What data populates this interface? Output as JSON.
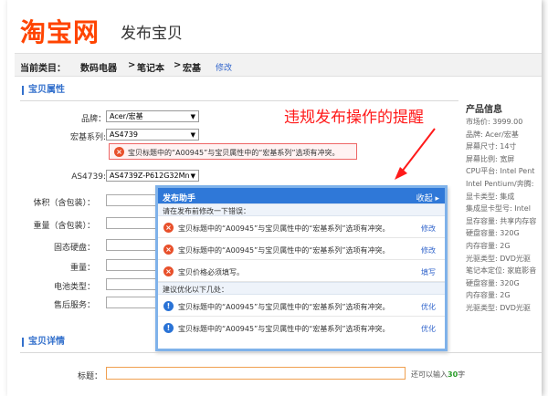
{
  "header": {
    "logo": "淘宝网",
    "title": "发布宝贝"
  },
  "category": {
    "label": "当前类目：",
    "path": [
      "数码电器",
      "笔记本",
      "宏基"
    ],
    "separator": ">",
    "edit": "修改"
  },
  "attributes": {
    "section_title": "宝贝属性",
    "brand": {
      "label": "品牌：",
      "value": "Acer/宏基"
    },
    "series": {
      "label": "宏基系列:",
      "value": "AS4739"
    },
    "series_error": "宝贝标题中的“A00945”与宝贝属性中的“宏基系列”选项有冲突。",
    "model": {
      "label": "AS4739:",
      "value": "AS4739Z-P612G32Mn"
    },
    "other_labels": [
      "体积（含包装）：",
      "重量（含包装）：",
      "固态硬盘：",
      "重量：",
      "电池类型：",
      "售后服务："
    ]
  },
  "annotation": "违规发布操作的提醒",
  "dialog": {
    "title": "发布助手",
    "collapse": "收起 ▸",
    "errors_header": "请在发布前修改一下错误：",
    "errors": [
      {
        "text": "宝贝标题中的“A00945”与宝贝属性中的“宏基系列”选项有冲突。",
        "action": "修改"
      },
      {
        "text": "宝贝标题中的“A00945”与宝贝属性中的“宏基系列”选项有冲突。",
        "action": "修改"
      },
      {
        "text": "宝贝价格必须填写。",
        "action": "填写"
      }
    ],
    "suggest_header": "建议优化以下几处：",
    "suggestions": [
      {
        "text": "宝贝标题中的“A00945”与宝贝属性中的“宏基系列”选项有冲突。",
        "action": "优化"
      },
      {
        "text": "宝贝标题中的“A00945”与宝贝属性中的“宏基系列”选项有冲突。",
        "action": "优化"
      }
    ]
  },
  "product_info": {
    "title": "产品信息",
    "lines": [
      "市场价: 3999.00",
      "品牌: Acer/宏基",
      "屏幕尺寸: 14寸",
      "屏幕比例: 宽屏",
      "CPU平台: Intel Pent",
      "Intel Pentium/奔腾:",
      "显卡类型: 集成",
      "集成显卡型号: Intel",
      "显存容量: 共享内存容",
      "硬盘容量: 320G",
      "内存容量: 2G",
      "光驱类型: DVD光驱",
      "笔记本定位: 家庭影音",
      "硬盘容量: 320G",
      "内存容量: 2G",
      "光驱类型: DVD光驱"
    ]
  },
  "detail": {
    "section_title": "宝贝详情",
    "title_label": "标题：",
    "hint_prefix": "还可以输入",
    "hint_count": "30",
    "hint_suffix": "字"
  },
  "colors": {
    "brand": "#ff4400",
    "accent": "#2f78d8",
    "annotation": "#ff1a1a",
    "error": "#e8502b"
  }
}
